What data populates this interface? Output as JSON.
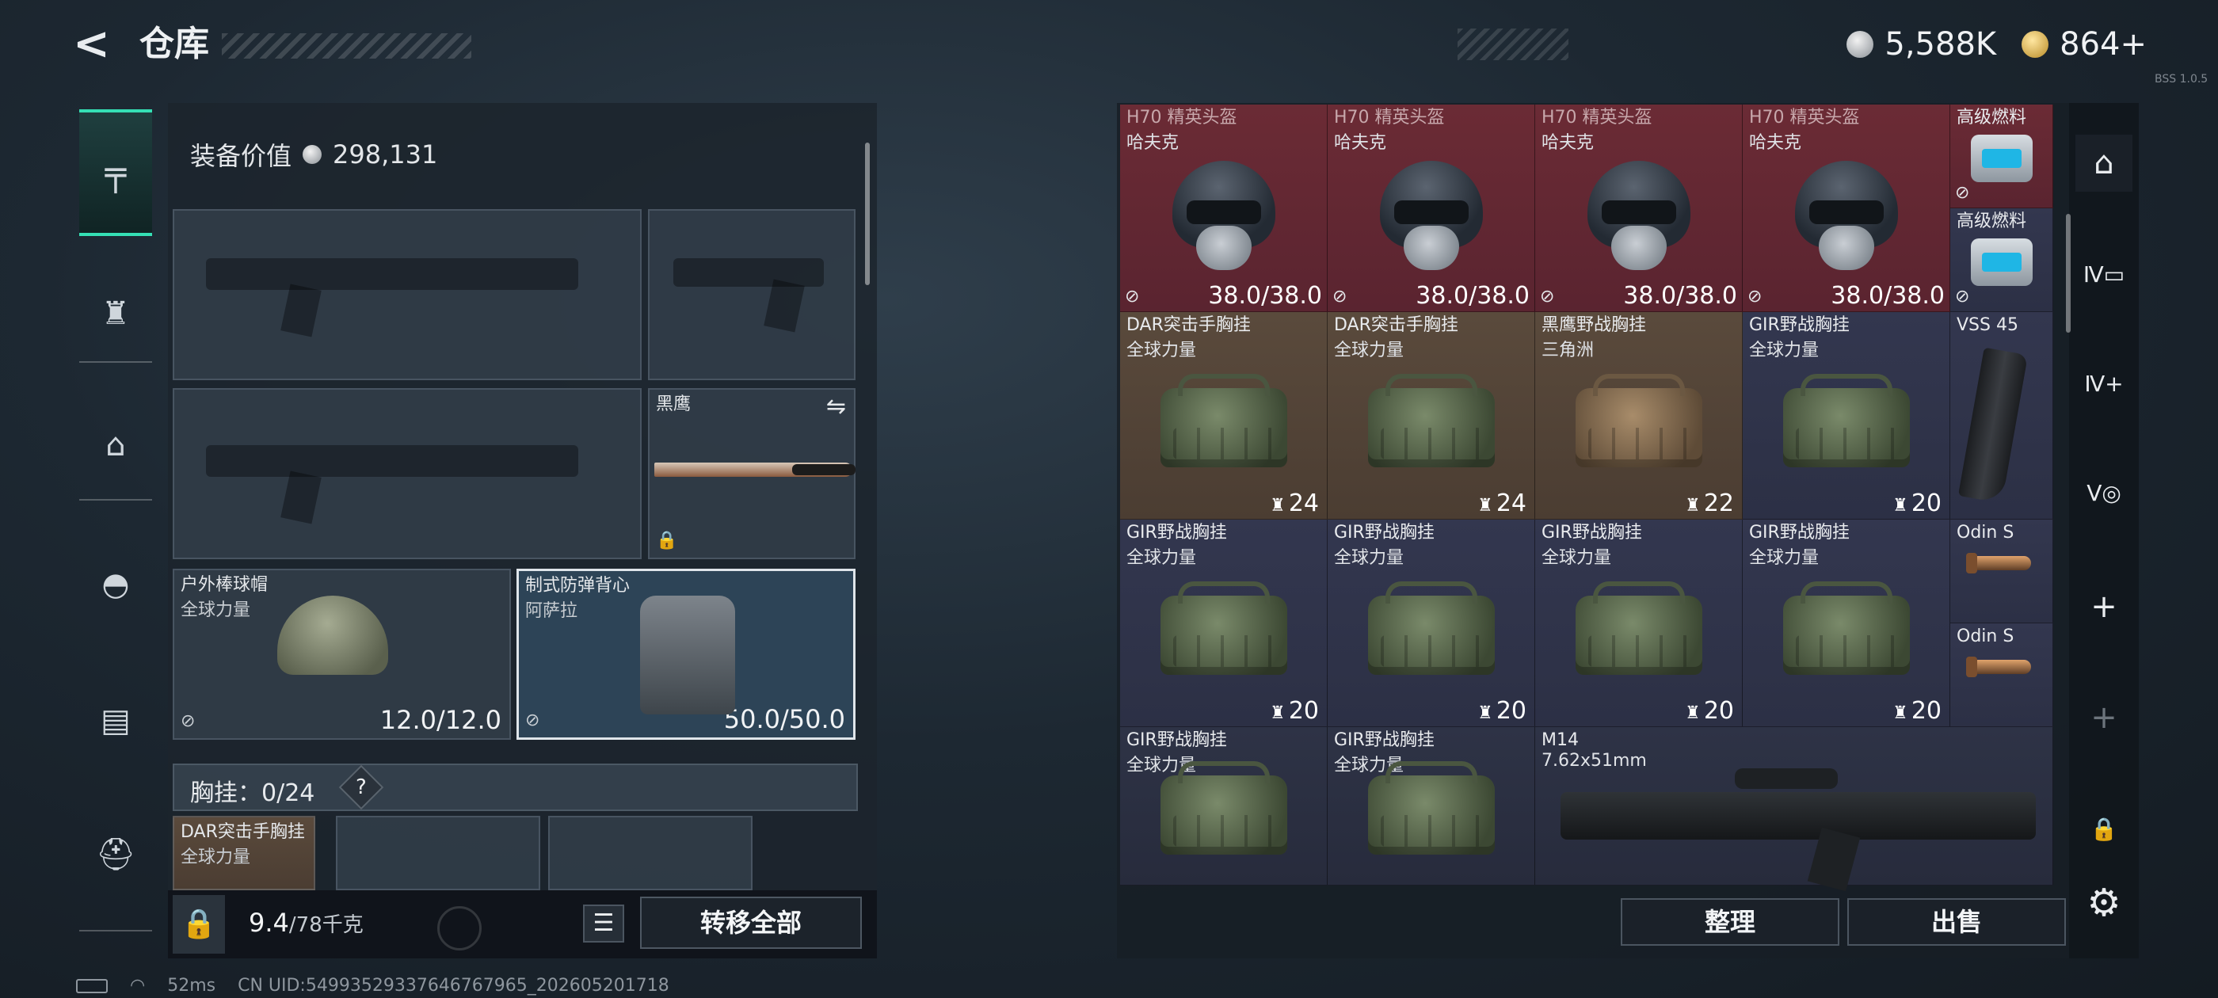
{
  "header": {
    "back_icon": "back-arrow-icon",
    "title": "仓库"
  },
  "currency": {
    "coin_amount": "5,588K",
    "premium_amount": "864+"
  },
  "top_right_small": "BSS 1.0.5",
  "left_tabs": [
    {
      "name": "pistol-icon",
      "glyph": "╤"
    },
    {
      "name": "armor-icon",
      "glyph": "♜"
    },
    {
      "name": "backpack-icon",
      "glyph": "⌂"
    },
    {
      "name": "helmet-icon",
      "glyph": "◓"
    },
    {
      "name": "container-icon",
      "glyph": "▤"
    },
    {
      "name": "toolbox-icon",
      "glyph": "⛑"
    }
  ],
  "loadout": {
    "equip_value_label": "装备价值",
    "equip_value": "298,131",
    "melee": {
      "name": "黑鹰"
    },
    "helmet": {
      "name": "户外棒球帽",
      "sub": "全球力量",
      "durability": "12.0/12.0"
    },
    "armor": {
      "name": "制式防弹背心",
      "sub": "阿萨拉",
      "durability": "50.0/50.0"
    },
    "chest_rig_label": "胸挂：0/24",
    "chest_rig_help": "?",
    "chest_rig_item": {
      "name": "DAR突击手胸挂",
      "sub": "全球力量"
    },
    "weight": "9.4",
    "weight_max": "/78千克",
    "transfer_all": "转移全部"
  },
  "stash": {
    "cells": [
      {
        "name": "H70 精英头盔",
        "sub": "哈夫克",
        "dur": "38.0/38.0",
        "kind": "helmet",
        "bg": "red"
      },
      {
        "name": "H70 精英头盔",
        "sub": "哈夫克",
        "dur": "38.0/38.0",
        "kind": "helmet",
        "bg": "red"
      },
      {
        "name": "H70 精英头盔",
        "sub": "哈夫克",
        "dur": "38.0/38.0",
        "kind": "helmet",
        "bg": "red"
      },
      {
        "name": "H70 精英头盔",
        "sub": "哈夫克",
        "dur": "38.0/38.0",
        "kind": "helmet",
        "bg": "red"
      },
      {
        "name": "DAR突击手胸挂",
        "sub": "全球力量",
        "count": "24",
        "kind": "bag",
        "bg": "brown"
      },
      {
        "name": "DAR突击手胸挂",
        "sub": "全球力量",
        "count": "24",
        "kind": "bag",
        "bg": "brown"
      },
      {
        "name": "黑鹰野战胸挂",
        "sub": "三角洲",
        "count": "22",
        "kind": "bag-tan",
        "bg": "brown"
      },
      {
        "name": "GIR野战胸挂",
        "sub": "全球力量",
        "count": "20",
        "kind": "bag",
        "bg": "navy"
      },
      {
        "name": "GIR野战胸挂",
        "sub": "全球力量",
        "count": "20",
        "kind": "bag",
        "bg": "navy"
      },
      {
        "name": "GIR野战胸挂",
        "sub": "全球力量",
        "count": "20",
        "kind": "bag",
        "bg": "navy"
      },
      {
        "name": "GIR野战胸挂",
        "sub": "全球力量",
        "count": "20",
        "kind": "bag",
        "bg": "navy"
      },
      {
        "name": "GIR野战胸挂",
        "sub": "全球力量",
        "count": "20",
        "kind": "bag",
        "bg": "navy"
      },
      {
        "name": "GIR野战胸挂",
        "sub": "全球力量",
        "kind": "bag",
        "bg": "navy2"
      },
      {
        "name": "GIR野战胸挂",
        "sub": "全球力量",
        "kind": "bag",
        "bg": "navy2"
      }
    ],
    "fuel": [
      {
        "name": "高级燃料"
      },
      {
        "name": "高级燃料"
      }
    ],
    "vss_mag": {
      "name": "VSS 45"
    },
    "scopes": [
      {
        "name": "Odin S"
      },
      {
        "name": "Odin S"
      }
    ],
    "rifle": {
      "name": "M14",
      "sub": "7.62x51mm"
    },
    "sort_label": "整理",
    "sell_label": "出售"
  },
  "right_rail": [
    {
      "name": "stash-home-icon",
      "glyph": "⌂"
    },
    {
      "name": "stash-tier4-icon",
      "glyph": "Ⅳ▭"
    },
    {
      "name": "stash-tier4-add-icon",
      "glyph": "Ⅳ+"
    },
    {
      "name": "stash-tier5-icon",
      "glyph": "Ⅴ◎"
    },
    {
      "name": "add-stash-icon",
      "glyph": "+"
    },
    {
      "name": "add-stash-disabled-icon",
      "glyph": "+"
    },
    {
      "name": "lock-icon",
      "glyph": "🔒"
    },
    {
      "name": "settings-icon",
      "glyph": "⚙"
    }
  ],
  "status": {
    "ping": "52ms",
    "uid": "CN UID:5499352933764676796​5_202605201718"
  }
}
